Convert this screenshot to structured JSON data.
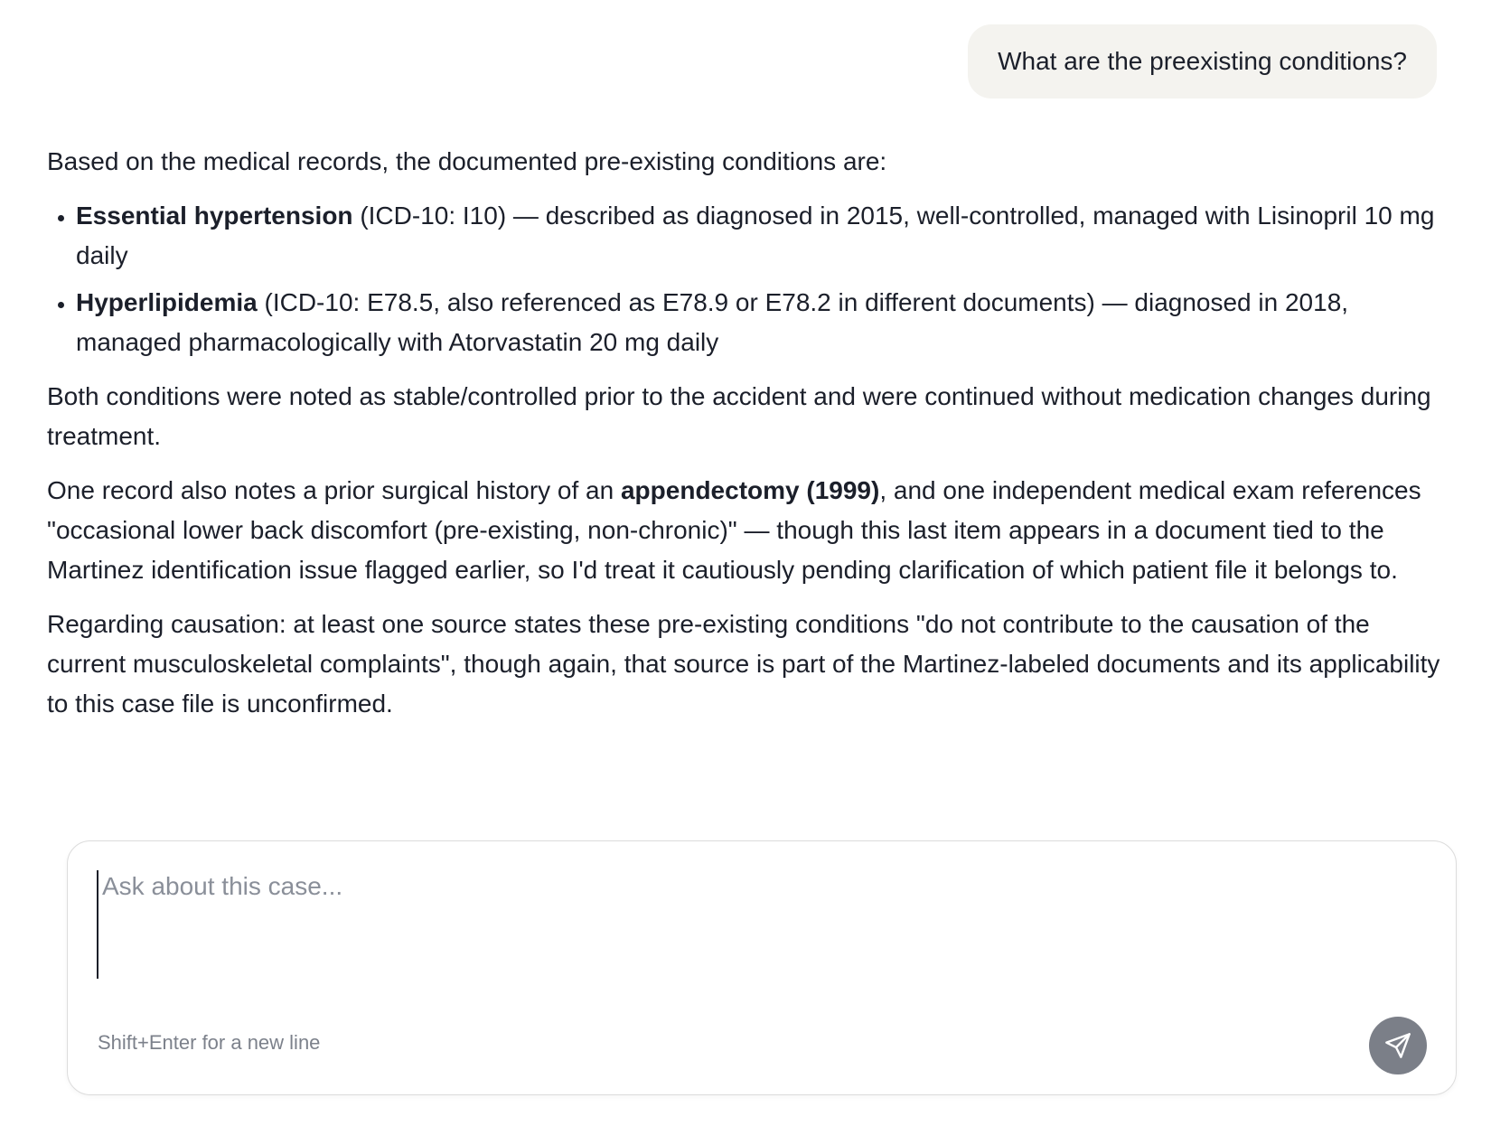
{
  "user_message": "What are the preexisting conditions?",
  "answer": {
    "intro": "Based on the medical records, the documented pre-existing conditions are:",
    "conditions": [
      {
        "name": "Essential hypertension",
        "detail": " (ICD-10: I10) — described as diagnosed in 2015, well-controlled, managed with Lisinopril 10 mg daily"
      },
      {
        "name": "Hyperlipidemia",
        "detail": " (ICD-10: E78.5, also referenced as E78.9 or E78.2 in different documents) — diagnosed in 2018, managed pharmacologically with Atorvastatin 20 mg daily"
      }
    ],
    "both_note": "Both conditions were noted as stable/controlled prior to the accident and were continued without medication changes during treatment.",
    "surgical": {
      "before": "One record also notes a prior surgical history of an ",
      "bold": "appendectomy (1999)",
      "after": ", and one independent medical exam references \"occasional lower back discomfort (pre-existing, non-chronic)\" — though this last item appears in a document tied to the Martinez identification issue flagged earlier, so I'd treat it cautiously pending clarification of which patient file it belongs to."
    },
    "causation": "Regarding causation: at least one source states these pre-existing conditions \"do not contribute to the causation of the current musculoskeletal complaints\", though again, that source is part of the Martinez-labeled documents and its applicability to this case file is unconfirmed."
  },
  "composer": {
    "placeholder": "Ask about this case...",
    "value": "",
    "hint": "Shift+Enter for a new line",
    "send_icon": "send-arrow-icon"
  },
  "colors": {
    "user_bubble": "#f4f3ef",
    "send_button": "#7b7f88",
    "text": "#1b1f2a"
  }
}
